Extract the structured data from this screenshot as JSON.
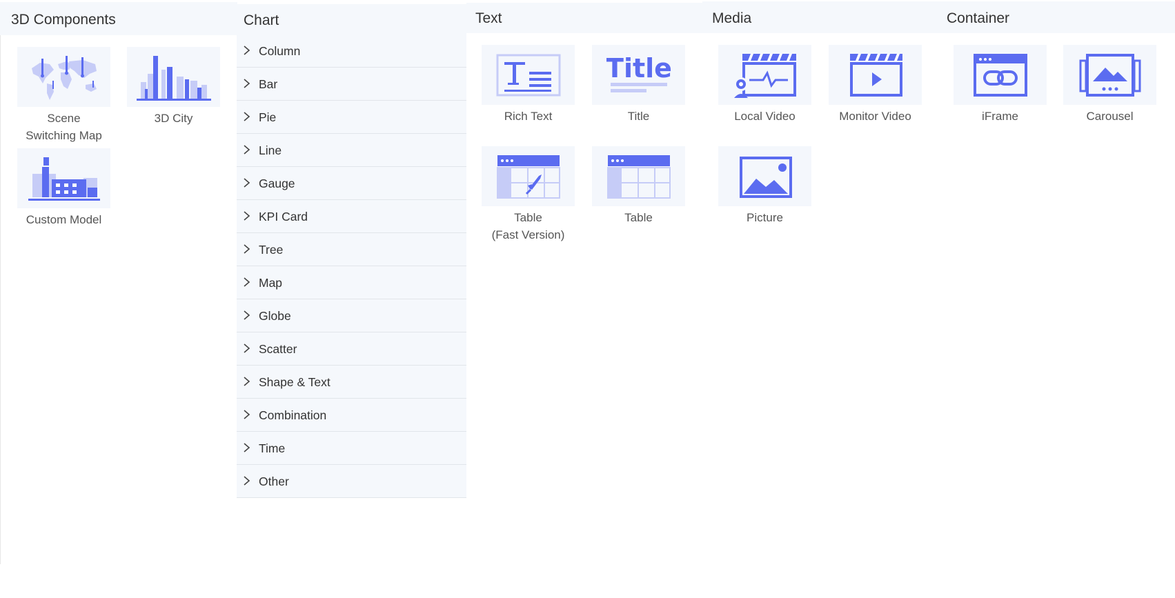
{
  "panels": {
    "components3d": {
      "title": "3D Components",
      "items": [
        {
          "label": "Scene\nSwitching Map",
          "icon": "world-map-icon"
        },
        {
          "label": "3D City",
          "icon": "city-skyline-icon"
        },
        {
          "label": "Custom Model",
          "icon": "factory-icon"
        }
      ]
    },
    "chart": {
      "title": "Chart",
      "items": [
        "Column",
        "Bar",
        "Pie",
        "Line",
        "Gauge",
        "KPI Card",
        "Tree",
        "Map",
        "Globe",
        "Scatter",
        "Shape & Text",
        "Combination",
        "Time",
        "Other"
      ]
    },
    "text": {
      "title": "Text",
      "items": [
        {
          "label": "Rich Text",
          "icon": "rich-text-icon"
        },
        {
          "label": "Title",
          "icon": "title-text-icon"
        },
        {
          "label": "Table\n(Fast Version)",
          "icon": "table-rocket-icon"
        },
        {
          "label": "Table",
          "icon": "table-icon"
        }
      ]
    },
    "media": {
      "title": "Media",
      "items": [
        {
          "label": "Local Video",
          "icon": "local-video-icon"
        },
        {
          "label": "Monitor Video",
          "icon": "monitor-video-icon"
        },
        {
          "label": "Picture",
          "icon": "picture-icon"
        }
      ]
    },
    "container": {
      "title": "Container",
      "items": [
        {
          "label": "iFrame",
          "icon": "iframe-link-icon"
        },
        {
          "label": "Carousel",
          "icon": "carousel-icon"
        }
      ]
    }
  },
  "colors": {
    "accent": "#5b6cf0",
    "accent_light": "#c6ccf7",
    "header_bg": "#f5f8fc",
    "thumb_bg": "#f4f7fc"
  }
}
